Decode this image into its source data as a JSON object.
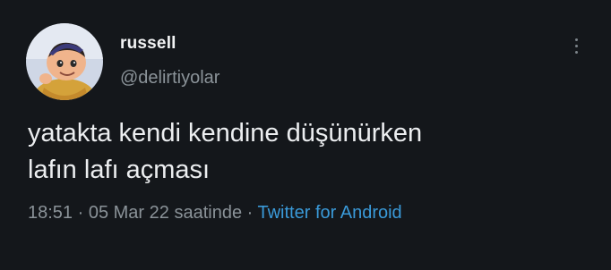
{
  "user": {
    "display_name": "russell",
    "handle": "@delirtiyolar",
    "avatar_icon": "avatar-cartoon-boy"
  },
  "tweet": {
    "text": "yatakta kendi kendine düşünürken\nlafın lafı açması",
    "time": "18:51",
    "separator1": " · ",
    "date": "05 Mar 22 saatinde",
    "separator2": " · ",
    "source": "Twitter for Android"
  },
  "actions": {
    "more_icon": "more-vertical-icon"
  },
  "colors": {
    "background": "#14171b",
    "text": "#eceef0",
    "secondary": "#8b9399",
    "link": "#3a9ad9"
  }
}
